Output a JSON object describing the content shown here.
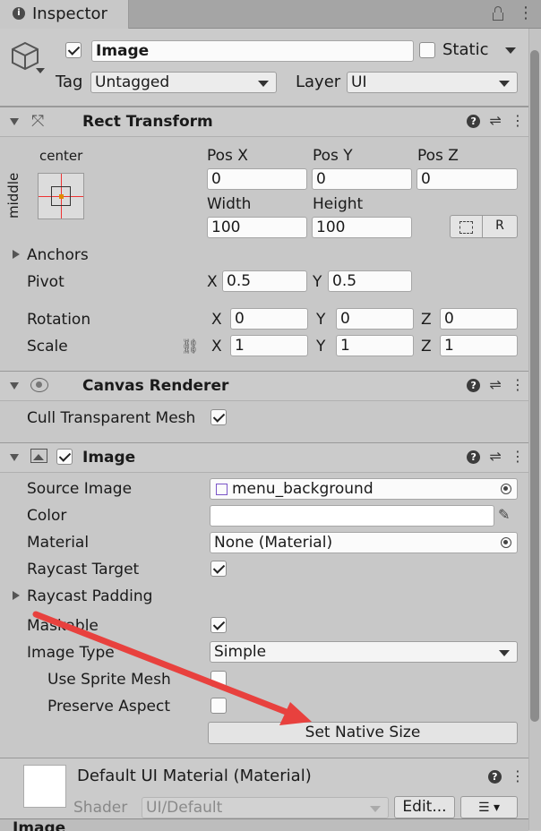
{
  "tab": {
    "title": "Inspector",
    "info_glyph": "i"
  },
  "gameobject": {
    "name": "Image",
    "active": true,
    "static_label": "Static",
    "tag_label": "Tag",
    "tag_value": "Untagged",
    "layer_label": "Layer",
    "layer_value": "UI"
  },
  "rect_transform": {
    "title": "Rect Transform",
    "anchor_h": "center",
    "anchor_v": "middle",
    "pos_x_label": "Pos X",
    "pos_x": "0",
    "pos_y_label": "Pos Y",
    "pos_y": "0",
    "pos_z_label": "Pos Z",
    "pos_z": "0",
    "width_label": "Width",
    "width": "100",
    "height_label": "Height",
    "height": "100",
    "raw_label": "R",
    "anchors_label": "Anchors",
    "pivot_label": "Pivot",
    "pivot_x": "0.5",
    "pivot_y": "0.5",
    "rotation_label": "Rotation",
    "rot_x": "0",
    "rot_y": "0",
    "rot_z": "0",
    "scale_label": "Scale",
    "scale_x": "1",
    "scale_y": "1",
    "scale_z": "1",
    "x": "X",
    "y": "Y",
    "z": "Z"
  },
  "canvas_renderer": {
    "title": "Canvas Renderer",
    "cull_label": "Cull Transparent Mesh",
    "cull": true
  },
  "image": {
    "title": "Image",
    "enabled": true,
    "source_label": "Source Image",
    "source_value": "menu_background",
    "color_label": "Color",
    "color_value": "#ffffff",
    "material_label": "Material",
    "material_value": "None (Material)",
    "raycast_target_label": "Raycast Target",
    "raycast_target": true,
    "raycast_padding_label": "Raycast Padding",
    "maskable_label": "Maskable",
    "maskable": true,
    "image_type_label": "Image Type",
    "image_type_value": "Simple",
    "use_sprite_mesh_label": "Use Sprite Mesh",
    "preserve_aspect_label": "Preserve Aspect",
    "native_size_label": "Set Native Size"
  },
  "material": {
    "title": "Default UI Material (Material)",
    "shader_label": "Shader",
    "shader_value": "UI/Default",
    "edit_label": "Edit..."
  },
  "footer_label": "Image",
  "colors": {
    "arrow": "#e8413e",
    "header": "#cbcbcb",
    "body": "#c8c8c8"
  }
}
